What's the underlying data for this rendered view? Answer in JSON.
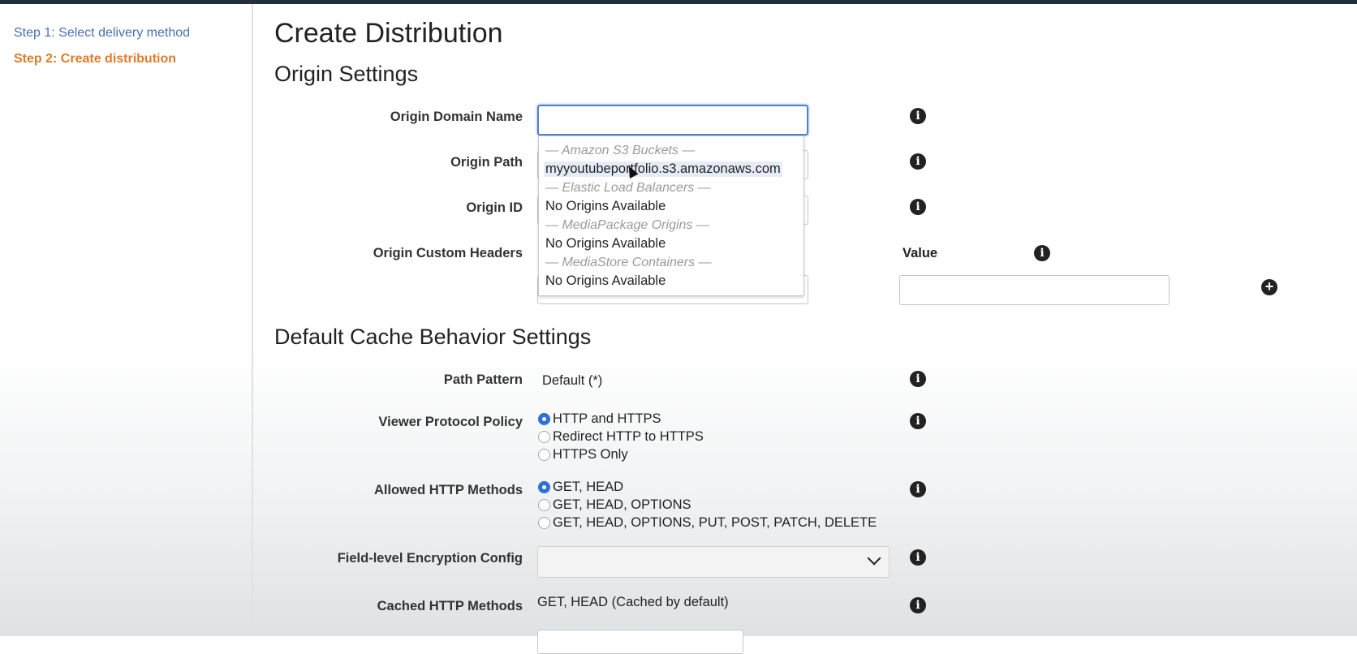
{
  "sidebar": {
    "steps": [
      {
        "label": "Step 1: Select delivery method"
      },
      {
        "label": "Step 2: Create distribution"
      }
    ]
  },
  "page": {
    "title": "Create Distribution",
    "origin_section": "Origin Settings",
    "cache_section": "Default Cache Behavior Settings"
  },
  "origin": {
    "domain_label": "Origin Domain Name",
    "domain_value": "",
    "path_label": "Origin Path",
    "id_label": "Origin ID",
    "headers_label": "Origin Custom Headers",
    "value_label": "Value"
  },
  "dropdown": {
    "groups": [
      {
        "label": "— Amazon S3 Buckets —",
        "items": [
          "myyoutubeportfolio.s3.amazonaws.com"
        ]
      },
      {
        "label": "— Elastic Load Balancers —",
        "items": [
          "No Origins Available"
        ]
      },
      {
        "label": "— MediaPackage Origins —",
        "items": [
          "No Origins Available"
        ]
      },
      {
        "label": "— MediaStore Containers —",
        "items": [
          "No Origins Available"
        ]
      }
    ]
  },
  "cache": {
    "path_pattern_label": "Path Pattern",
    "path_pattern_value": "Default (*)",
    "viewer_protocol_label": "Viewer Protocol Policy",
    "viewer_protocol_options": [
      "HTTP and HTTPS",
      "Redirect HTTP to HTTPS",
      "HTTPS Only"
    ],
    "viewer_protocol_selected": 0,
    "allowed_methods_label": "Allowed HTTP Methods",
    "allowed_methods_options": [
      "GET, HEAD",
      "GET, HEAD, OPTIONS",
      "GET, HEAD, OPTIONS, PUT, POST, PATCH, DELETE"
    ],
    "allowed_methods_selected": 0,
    "fle_label": "Field-level Encryption Config",
    "fle_value": "",
    "cached_methods_label": "Cached HTTP Methods",
    "cached_methods_value": "GET, HEAD (Cached by default)"
  },
  "icons": {
    "info": "info-icon",
    "add": "plus-circle-icon",
    "chevron": "chevron-down-icon"
  },
  "colors": {
    "step_link": "#4a6fb3",
    "step_active": "#e07b2b",
    "focus": "#4f82c9",
    "radio_on": "#2f6fd6"
  }
}
